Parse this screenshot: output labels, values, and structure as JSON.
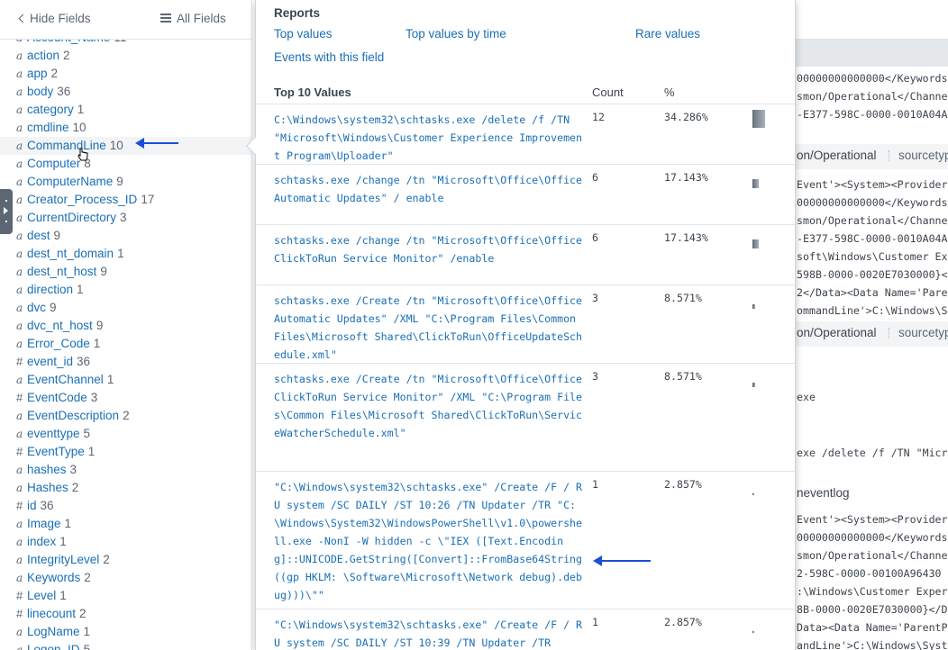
{
  "left_panel": {
    "hide_fields_label": "Hide Fields",
    "all_fields_label": "All Fields",
    "fields": [
      {
        "type": "a",
        "name": "Account_Name",
        "count": "11"
      },
      {
        "type": "a",
        "name": "action",
        "count": "2"
      },
      {
        "type": "a",
        "name": "app",
        "count": "2"
      },
      {
        "type": "a",
        "name": "body",
        "count": "36"
      },
      {
        "type": "a",
        "name": "category",
        "count": "1"
      },
      {
        "type": "a",
        "name": "cmdline",
        "count": "10"
      },
      {
        "type": "a",
        "name": "CommandLine",
        "count": "10"
      },
      {
        "type": "a",
        "name": "Computer",
        "count": "8"
      },
      {
        "type": "a",
        "name": "ComputerName",
        "count": "9"
      },
      {
        "type": "a",
        "name": "Creator_Process_ID",
        "count": "17"
      },
      {
        "type": "a",
        "name": "CurrentDirectory",
        "count": "3"
      },
      {
        "type": "a",
        "name": "dest",
        "count": "9"
      },
      {
        "type": "a",
        "name": "dest_nt_domain",
        "count": "1"
      },
      {
        "type": "a",
        "name": "dest_nt_host",
        "count": "9"
      },
      {
        "type": "a",
        "name": "direction",
        "count": "1"
      },
      {
        "type": "a",
        "name": "dvc",
        "count": "9"
      },
      {
        "type": "a",
        "name": "dvc_nt_host",
        "count": "9"
      },
      {
        "type": "a",
        "name": "Error_Code",
        "count": "1"
      },
      {
        "type": "#",
        "name": "event_id",
        "count": "36"
      },
      {
        "type": "a",
        "name": "EventChannel",
        "count": "1"
      },
      {
        "type": "#",
        "name": "EventCode",
        "count": "3"
      },
      {
        "type": "a",
        "name": "EventDescription",
        "count": "2"
      },
      {
        "type": "a",
        "name": "eventtype",
        "count": "5"
      },
      {
        "type": "#",
        "name": "EventType",
        "count": "1"
      },
      {
        "type": "a",
        "name": "hashes",
        "count": "3"
      },
      {
        "type": "a",
        "name": "Hashes",
        "count": "2"
      },
      {
        "type": "#",
        "name": "id",
        "count": "36"
      },
      {
        "type": "a",
        "name": "Image",
        "count": "1"
      },
      {
        "type": "a",
        "name": "index",
        "count": "1"
      },
      {
        "type": "a",
        "name": "IntegrityLevel",
        "count": "2"
      },
      {
        "type": "a",
        "name": "Keywords",
        "count": "2"
      },
      {
        "type": "#",
        "name": "Level",
        "count": "1"
      },
      {
        "type": "#",
        "name": "linecount",
        "count": "2"
      },
      {
        "type": "a",
        "name": "LogName",
        "count": "1"
      },
      {
        "type": "a",
        "name": "Logon_ID",
        "count": "5"
      }
    ]
  },
  "popup": {
    "reports_title": "Reports",
    "links": {
      "top_values": "Top values",
      "top_values_by_time": "Top values by time",
      "rare_values": "Rare values",
      "events_with_field": "Events with this field"
    },
    "table_title": "Top 10 Values",
    "col_count": "Count",
    "col_pct": "%",
    "values": [
      {
        "text": "C:\\Windows\\system32\\schtasks.exe /delete /f /TN \"Microsoft\\Windows\\Customer Experience Improvement Program\\Uploader\"",
        "count": "12",
        "pct": "34.286%",
        "frac": 0.34286
      },
      {
        "text": "schtasks.exe /change /tn \"Microsoft\\Office\\Office Automatic Updates\" / enable",
        "count": "6",
        "pct": "17.143%",
        "frac": 0.17143
      },
      {
        "text": "schtasks.exe /change /tn \"Microsoft\\Office\\Office ClickToRun Service Monitor\" /enable",
        "count": "6",
        "pct": "17.143%",
        "frac": 0.17143
      },
      {
        "text": "schtasks.exe /Create /tn \"Microsoft\\Office\\Office Automatic Updates\" /XML \"C:\\Program Files\\Common Files\\Microsoft Shared\\ClickToRun\\OfficeUpdateSchedule.xml\"",
        "count": "3",
        "pct": "8.571%",
        "frac": 0.08571
      },
      {
        "text": "schtasks.exe /Create /tn \"Microsoft\\Office\\Office ClickToRun Service Monitor\" /XML \"C:\\Program Files\\Common Files\\Microsoft Shared\\ClickToRun\\ServiceWatcherSchedule.xml\"",
        "count": "3",
        "pct": "8.571%",
        "frac": 0.08571
      },
      {
        "text": "\"C:\\Windows\\system32\\schtasks.exe\" /Create /F / RU system /SC DAILY /ST 10:26 /TN Updater /TR \"C: \\Windows\\System32\\WindowsPowerShell\\v1.0\\powershell.exe -NonI -W hidden -c \\\"IEX ([Text.Encoding]::UNICODE.GetString([Convert]::FromBase64String((gp HKLM: \\Software\\Microsoft\\Network debug).debug)))\\\"\"",
        "count": "1",
        "pct": "2.857%",
        "frac": 0.02857
      },
      {
        "text": "\"C:\\Windows\\system32\\schtasks.exe\" /Create /F / RU system /SC DAILY /ST 10:39 /TN Updater /TR",
        "count": "1",
        "pct": "2.857%",
        "frac": 0.02857
      }
    ]
  },
  "background": {
    "lines": [
      {
        "text": "00000000000000</Keywords><"
      },
      {
        "text": "smon/Operational</Channel><"
      },
      {
        "text": "-E377-598C-0000-0010A04A2"
      },
      {
        "text": "on/Operational",
        "sans": true,
        "extra": "sourcetyp"
      },
      {
        "text": "Event'><System><Provider"
      },
      {
        "text": "00000000000000</Keywords><"
      },
      {
        "text": "smon/Operational</Channel><"
      },
      {
        "text": "-E377-598C-0000-0010A04A2"
      },
      {
        "text": "soft\\Windows\\Customer Exp"
      },
      {
        "text": "598B-0000-0020E7030000}</"
      },
      {
        "text": "2</Data><Data Name='Paren"
      },
      {
        "text": "ommandLine'>C:\\Windows\\Sy"
      },
      {
        "text": "on/Operational",
        "sans": true,
        "extra": "sourcetyp"
      },
      {
        "text": "exe"
      },
      {
        "text": "exe /delete /f /TN \"Micro"
      },
      {
        "text": "neventlog",
        "sans": true
      },
      {
        "text": "Event'><System><Provider"
      },
      {
        "text": "00000000000000</Keywords><"
      },
      {
        "text": "smon/Operational</Channel><"
      },
      {
        "text": "2-598C-0000-00100A96430"
      },
      {
        "text": ":\\Windows\\Customer Experi"
      },
      {
        "text": "8B-0000-0020E7030000}</Da"
      },
      {
        "text": "Data><Data Name='ParentPr"
      },
      {
        "text": "andLine'>C:\\Windows\\Syste"
      }
    ]
  },
  "colors": {
    "link": "#1a6fb5",
    "arrow": "#1a4fd6",
    "text": "#3c444d"
  }
}
